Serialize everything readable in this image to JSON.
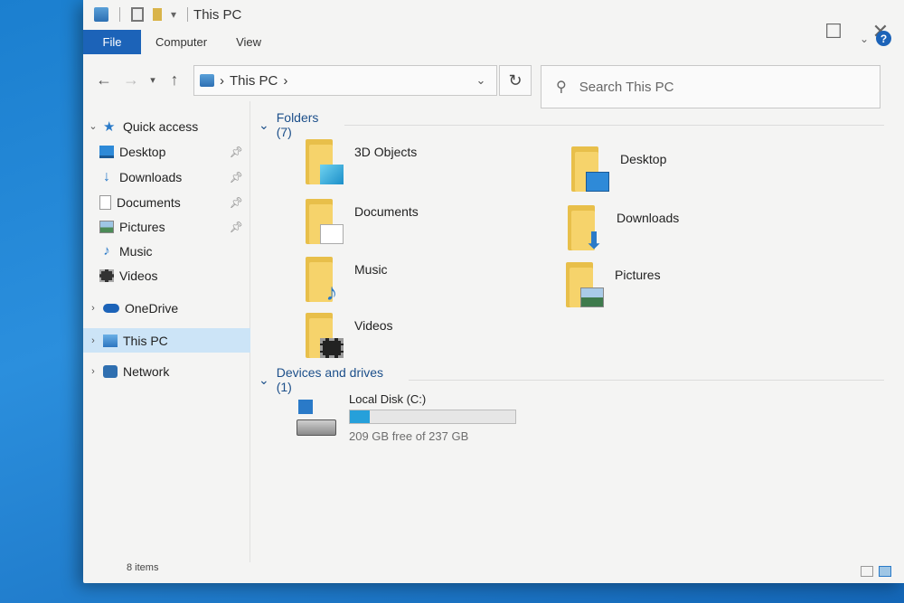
{
  "window": {
    "title": "This PC"
  },
  "ribbon": {
    "tabs": [
      "File",
      "Computer",
      "View"
    ],
    "help": "?"
  },
  "nav": {
    "address_location": "This PC",
    "search_placeholder": "Search This PC"
  },
  "sidebar": {
    "quick_access": "Quick access",
    "items": [
      "Desktop",
      "Downloads",
      "Documents",
      "Pictures",
      "Music",
      "Videos"
    ],
    "onedrive": "OneDrive",
    "this_pc": "This PC",
    "network": "Network"
  },
  "content": {
    "folders_header": "Folders (7)",
    "folders": [
      "3D Objects",
      "Desktop",
      "Documents",
      "Downloads",
      "Music",
      "Pictures",
      "Videos"
    ],
    "drives_header": "Devices and drives (1)",
    "drive": {
      "name": "Local Disk (C:)",
      "free_text": "209 GB free of 237 GB",
      "used_fraction": 0.118
    }
  },
  "status": {
    "items_count": "8 items"
  },
  "colors": {
    "accent": "#1c63b8",
    "selection": "#cce4f7",
    "drive_bar": "#26a0da"
  }
}
